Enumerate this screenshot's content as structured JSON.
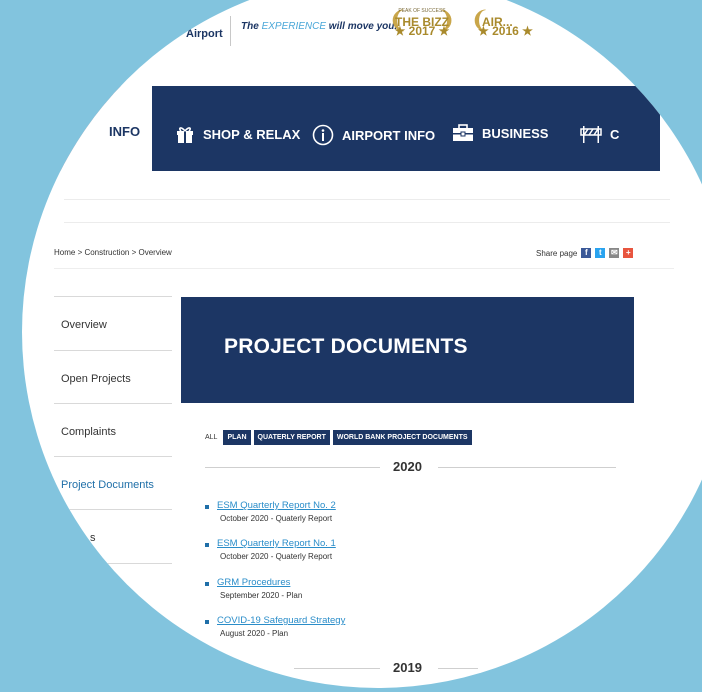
{
  "header": {
    "brand": "Airport",
    "slogan_prefix": "The ",
    "slogan_highlight": "EXPERIENCE",
    "slogan_suffix": " will move you.",
    "awards": [
      {
        "small": "PEAK OF SUCCESS",
        "big": "THE BIZZ",
        "year": "2017"
      },
      {
        "small": "",
        "big": "AIR...",
        "year": "2016"
      }
    ]
  },
  "nav": {
    "items": [
      {
        "label": "INFO"
      },
      {
        "label": "SHOP & RELAX"
      },
      {
        "label": "AIRPORT INFO"
      },
      {
        "label": "BUSINESS"
      },
      {
        "label": "C"
      }
    ]
  },
  "breadcrumb": "Home > Construction > Overview",
  "share": {
    "label": "Share page"
  },
  "sidebar": {
    "items": [
      {
        "label": "Overview"
      },
      {
        "label": "Open Projects"
      },
      {
        "label": "Complaints"
      },
      {
        "label": "Project Documents"
      },
      {
        "label": "s"
      }
    ]
  },
  "banner": {
    "title": "PROJECT DOCUMENTS"
  },
  "filters": {
    "all_label": "ALL",
    "chips": [
      "PLAN",
      "QUATERLY REPORT",
      "WORLD BANK PROJECT DOCUMENTS"
    ]
  },
  "years": [
    "2020",
    "2019"
  ],
  "documents": [
    {
      "title": "ESM Quarterly Report No. 2",
      "meta": "October 2020 - Quaterly Report"
    },
    {
      "title": "ESM Quarterly Report No. 1",
      "meta": "October 2020 - Quaterly Report"
    },
    {
      "title": "GRM Procedures",
      "meta": "September 2020 - Plan"
    },
    {
      "title": "COVID-19 Safeguard Strategy",
      "meta": "August 2020 - Plan"
    }
  ],
  "colors": {
    "navy": "#1c3664",
    "link": "#2a8dc9",
    "background": "#82c4de"
  }
}
